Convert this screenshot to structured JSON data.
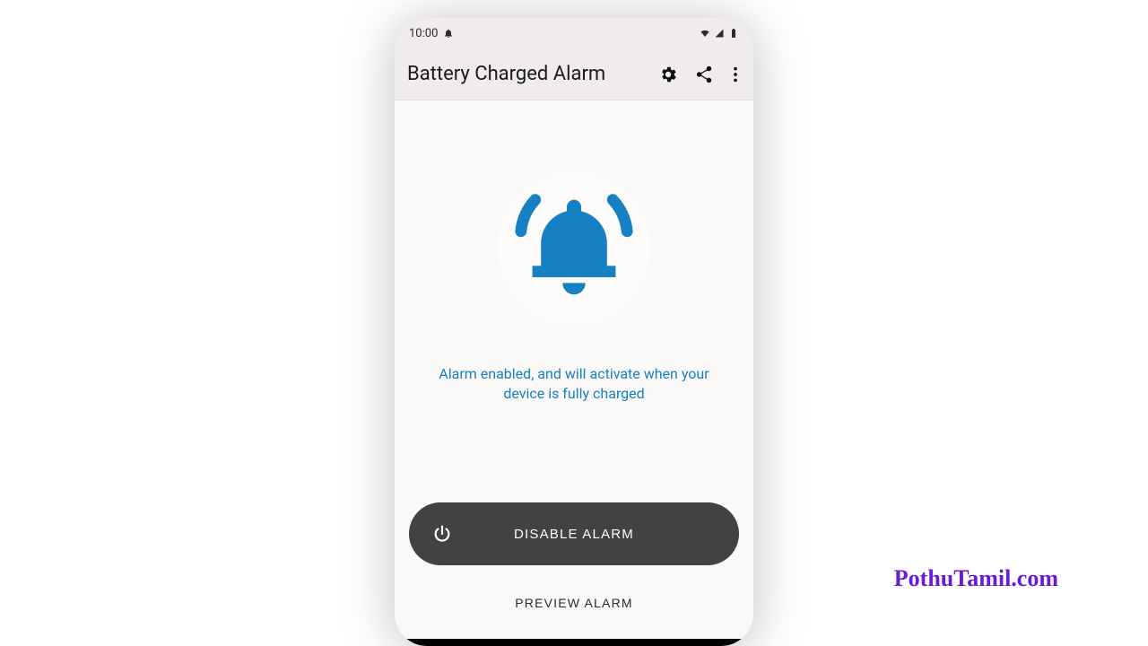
{
  "statusbar": {
    "time": "10:00",
    "notification_icon": "bell-icon",
    "wifi_icon": "wifi-icon",
    "signal_icon": "cellular-icon",
    "battery_icon": "battery-icon"
  },
  "appbar": {
    "title": "Battery Charged Alarm",
    "actions": {
      "settings": "gear-icon",
      "share": "share-icon",
      "overflow": "more-vert-icon"
    }
  },
  "main": {
    "bell_icon": "bell-ringing-icon",
    "status_text": "Alarm enabled, and will activate when your device is fully charged",
    "primary_button": {
      "icon": "power-icon",
      "label": "DISABLE ALARM"
    },
    "secondary_button": {
      "label": "PREVIEW ALARM"
    }
  },
  "watermark": "PothuTamil.com",
  "colors": {
    "accent_blue": "#1681c2",
    "button_dark": "#424242",
    "watermark_purple": "#6a1bd6"
  }
}
